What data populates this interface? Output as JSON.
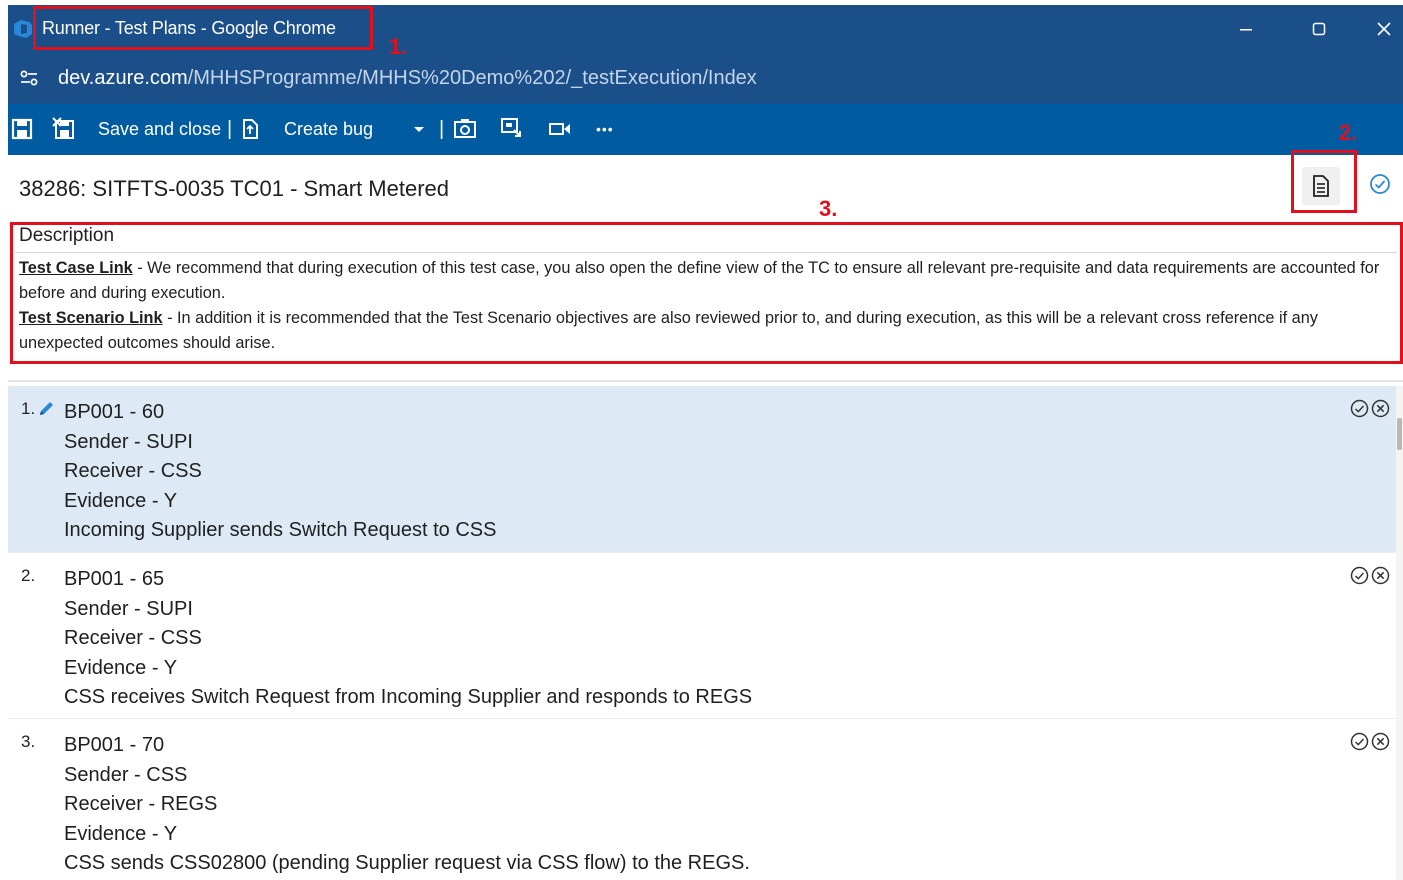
{
  "window": {
    "title": "Runner - Test Plans - Google Chrome",
    "min_glyph": "—",
    "close_glyph": "✕"
  },
  "address": {
    "host": "dev.azure.com",
    "path": "/MHHSProgramme/MHHS%20Demo%202/_testExecution/Index"
  },
  "toolbar": {
    "save_close_label": "Save and close",
    "separator": "|",
    "create_bug_label": "Create bug",
    "more_glyph": "•••"
  },
  "test_case": {
    "title": "38286: SITFTS-0035 TC01 - Smart Metered"
  },
  "description": {
    "heading": "Description",
    "case_link_label": "Test Case Link",
    "case_link_text": " - We recommend that during execution of this test case, you also open the define view of the TC to ensure all relevant pre-requisite and data requirements are accounted for before and during execution.",
    "scenario_link_label": "Test Scenario Link",
    "scenario_link_text": " - In addition it is recommended that the Test Scenario objectives are also reviewed prior to, and during execution, as this will be a relevant cross reference if any unexpected outcomes should arise."
  },
  "annotations": {
    "one": "1.",
    "two": "2.",
    "three": "3.",
    "color": "#e0101c"
  },
  "steps": [
    {
      "number": "1.",
      "selected": true,
      "lines": [
        "BP001 - 60",
        "Sender - SUPI",
        "Receiver - CSS",
        "Evidence - Y",
        "Incoming Supplier sends Switch Request to CSS"
      ]
    },
    {
      "number": "2.",
      "selected": false,
      "lines": [
        "BP001 - 65",
        "Sender - SUPI",
        "Receiver - CSS",
        "Evidence - Y",
        "CSS receives Switch Request from Incoming Supplier and responds to REGS"
      ]
    },
    {
      "number": "3.",
      "selected": false,
      "lines": [
        "BP001 - 70",
        "Sender - CSS",
        "Receiver - REGS",
        "Evidence - Y",
        "CSS sends CSS02800 (pending Supplier request via CSS flow) to the REGS."
      ]
    }
  ],
  "colors": {
    "titlebar": "#1b4f8a",
    "toolbar": "#005ba1",
    "selected_row": "#ddeaf6",
    "accent_blue": "#2b88d8"
  }
}
